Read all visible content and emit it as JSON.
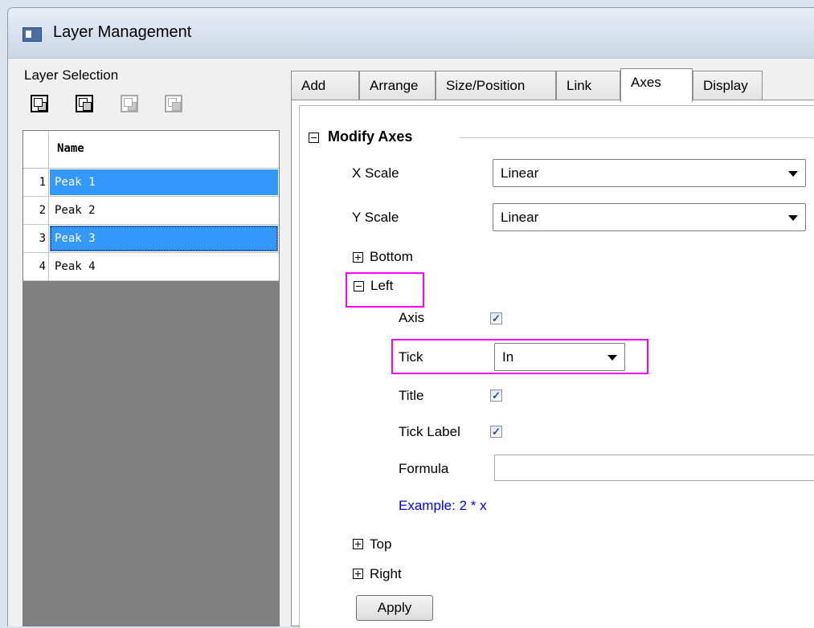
{
  "window": {
    "title": "Layer Management"
  },
  "layer_selection": {
    "label": "Layer Selection",
    "toolbar_icons": [
      "bring-to-front-icon",
      "send-to-back-icon",
      "bring-forward-icon",
      "send-backward-icon"
    ],
    "column_header": "Name",
    "rows": [
      {
        "num": "1",
        "name": "Peak 1",
        "selected": true
      },
      {
        "num": "2",
        "name": "Peak 2",
        "selected": false
      },
      {
        "num": "3",
        "name": "Peak 3",
        "selected": true
      },
      {
        "num": "4",
        "name": "Peak 4",
        "selected": false
      }
    ]
  },
  "tabs": [
    {
      "label": "Add",
      "active": false
    },
    {
      "label": "Arrange",
      "active": false
    },
    {
      "label": "Size/Position",
      "active": false
    },
    {
      "label": "Link",
      "active": false
    },
    {
      "label": "Axes",
      "active": true
    },
    {
      "label": "Display",
      "active": false
    }
  ],
  "modify_axes": {
    "title": "Modify Axes",
    "x_scale": {
      "label": "X Scale",
      "value": "Linear"
    },
    "y_scale": {
      "label": "Y Scale",
      "value": "Linear"
    },
    "bottom": "Bottom",
    "left": {
      "label": "Left",
      "axis": {
        "label": "Axis",
        "checked": true
      },
      "tick": {
        "label": "Tick",
        "value": "In"
      },
      "title": {
        "label": "Title",
        "checked": true
      },
      "tick_label": {
        "label": "Tick Label",
        "checked": true
      },
      "formula": {
        "label": "Formula",
        "value": ""
      },
      "example": "Example: 2 * x"
    },
    "top": "Top",
    "right": "Right",
    "apply": "Apply"
  },
  "colors": {
    "selection": "#3399ff",
    "highlight": "#ff00ff",
    "example_text": "#0000ff"
  }
}
